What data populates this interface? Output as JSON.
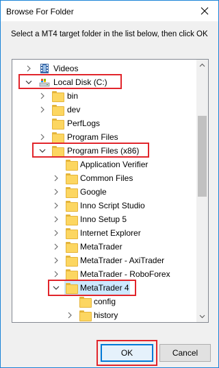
{
  "window": {
    "title": "Browse For Folder",
    "instruction": "Select a MT4 target folder in the list below, then click OK"
  },
  "tree": {
    "items": [
      {
        "label": "Videos",
        "level": 1,
        "expanded": false,
        "icon": "videos-icon"
      },
      {
        "label": "Local Disk (C:)",
        "level": 1,
        "expanded": true,
        "icon": "drive-icon",
        "highlighted": true
      },
      {
        "label": "bin",
        "level": 2,
        "expanded": false,
        "icon": "folder-icon"
      },
      {
        "label": "dev",
        "level": 2,
        "expanded": false,
        "icon": "folder-icon"
      },
      {
        "label": "PerfLogs",
        "level": 2,
        "expanded": null,
        "icon": "folder-icon"
      },
      {
        "label": "Program Files",
        "level": 2,
        "expanded": false,
        "icon": "folder-icon"
      },
      {
        "label": "Program Files (x86)",
        "level": 2,
        "expanded": true,
        "icon": "folder-icon",
        "highlighted": true
      },
      {
        "label": "Application Verifier",
        "level": 3,
        "expanded": null,
        "icon": "folder-icon"
      },
      {
        "label": "Common Files",
        "level": 3,
        "expanded": false,
        "icon": "folder-icon"
      },
      {
        "label": "Google",
        "level": 3,
        "expanded": false,
        "icon": "folder-icon"
      },
      {
        "label": "Inno Script Studio",
        "level": 3,
        "expanded": false,
        "icon": "folder-icon"
      },
      {
        "label": "Inno Setup 5",
        "level": 3,
        "expanded": false,
        "icon": "folder-icon"
      },
      {
        "label": "Internet Explorer",
        "level": 3,
        "expanded": false,
        "icon": "folder-icon"
      },
      {
        "label": "MetaTrader",
        "level": 3,
        "expanded": false,
        "icon": "folder-icon"
      },
      {
        "label": "MetaTrader - AxiTrader",
        "level": 3,
        "expanded": false,
        "icon": "folder-icon"
      },
      {
        "label": "MetaTrader - RoboForex",
        "level": 3,
        "expanded": false,
        "icon": "folder-icon"
      },
      {
        "label": "MetaTrader 4",
        "level": 3,
        "expanded": true,
        "icon": "folder-icon",
        "highlighted": true,
        "selected": true
      },
      {
        "label": "config",
        "level": 4,
        "expanded": null,
        "icon": "folder-icon"
      },
      {
        "label": "history",
        "level": 4,
        "expanded": false,
        "icon": "folder-icon"
      }
    ]
  },
  "buttons": {
    "ok_label": "OK",
    "cancel_label": "Cancel"
  },
  "colors": {
    "highlight_border": "#e1242a",
    "selection": "#cce8ff",
    "accent": "#0078d7"
  }
}
